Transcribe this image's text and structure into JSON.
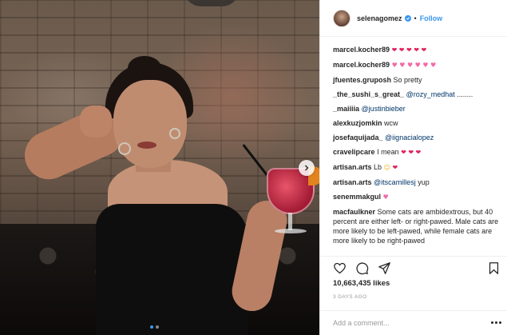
{
  "header": {
    "username": "selenagomez",
    "separator": "•",
    "follow_label": "Follow"
  },
  "comments": [
    {
      "user": "marcel.kocher89",
      "text": "",
      "emoji": [
        "❤",
        "❤",
        "❤",
        "❤",
        "❤"
      ],
      "emoji_style": "heart",
      "partial": true
    },
    {
      "user": "marcel.kocher89",
      "text": "",
      "emoji": [
        "❤",
        "❤",
        "❤",
        "❤",
        "❤"
      ],
      "emoji_style": "heart"
    },
    {
      "user": "marcel.kocher89",
      "text": "",
      "emoji": [
        "♥",
        "♥",
        "♥",
        "♥",
        "♥",
        "♥"
      ],
      "emoji_style": "pink"
    },
    {
      "user": "jfuentes.gruposh",
      "text": "So pretty"
    },
    {
      "user": "_the_sushi_s_great_",
      "mention": "@rozy_medhat",
      "text": " ........"
    },
    {
      "user": "_maiiiia",
      "mention": "@justinbieber",
      "text": ""
    },
    {
      "user": "alexkuzjomkin",
      "text": "wcw"
    },
    {
      "user": "josefaquijada_",
      "mention": "@iignacialopez",
      "text": ""
    },
    {
      "user": "cravelipcare",
      "text": "I mean",
      "emoji": [
        "❤",
        "❤",
        "❤"
      ],
      "emoji_style": "heart"
    },
    {
      "user": "artisan.arts",
      "text": "Lb",
      "emoji": [
        "☺",
        "❤"
      ],
      "emoji_style": "mixed"
    },
    {
      "user": "artisan.arts",
      "mention": "@itscamillesj",
      "text": " yup"
    },
    {
      "user": "senemmakgul",
      "text": "",
      "emoji": [
        "♥"
      ],
      "emoji_style": "pink"
    },
    {
      "user": "macfaulkner",
      "text": "Some cats are ambidextrous, but 40 percent are either left- or right-pawed. Male cats are more likely to be left-pawed, while female cats are more likely to be right-pawed"
    }
  ],
  "actions": {
    "like_icon": "heart-outline-icon",
    "comment_icon": "speech-bubble-icon",
    "share_icon": "paper-plane-icon",
    "save_icon": "bookmark-icon"
  },
  "likes_text": "10,663,435 likes",
  "date_text": "3 DAYS AGO",
  "add_comment": {
    "placeholder": "Add a comment..."
  },
  "colors": {
    "link_blue": "#3897f0",
    "mention_blue": "#003569",
    "text": "#262626",
    "muted": "#999999",
    "heart_red": "#e0245e",
    "heart_pink": "#f06aa7"
  }
}
